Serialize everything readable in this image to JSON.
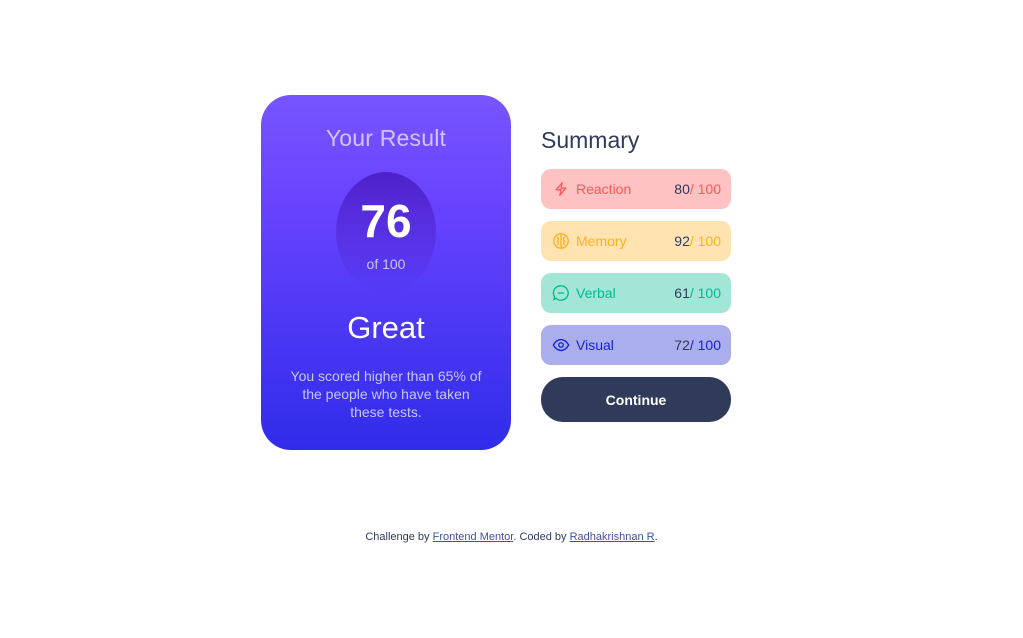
{
  "result": {
    "title": "Your Result",
    "score": "76",
    "of_label": "of 100",
    "verdict": "Great",
    "description": "You scored higher than 65% of the people who have taken these tests."
  },
  "summary": {
    "title": "Summary",
    "items": [
      {
        "label": "Reaction",
        "score": "80",
        "total": " / 100",
        "icon": "lightning-icon",
        "color": "#ff5757"
      },
      {
        "label": "Memory",
        "score": "92",
        "total": " / 100",
        "icon": "brain-icon",
        "color": "#ffb01f"
      },
      {
        "label": "Verbal",
        "score": "61",
        "total": " / 100",
        "icon": "chat-bubble-icon",
        "color": "#00bb8f"
      },
      {
        "label": "Visual",
        "score": "72",
        "total": " / 100",
        "icon": "eye-icon",
        "color": "#1125d6"
      }
    ],
    "continue_label": "Continue"
  },
  "footer": {
    "prefix": "Challenge by ",
    "link1": "Frontend Mentor",
    "middle": ". Coded by ",
    "link2": "Radhakrishnan R",
    "suffix": "."
  },
  "colors": {
    "accent_dark": "#303b5a",
    "card_gradient_top": "#7755ff",
    "card_gradient_bottom": "#2f2ce9"
  }
}
